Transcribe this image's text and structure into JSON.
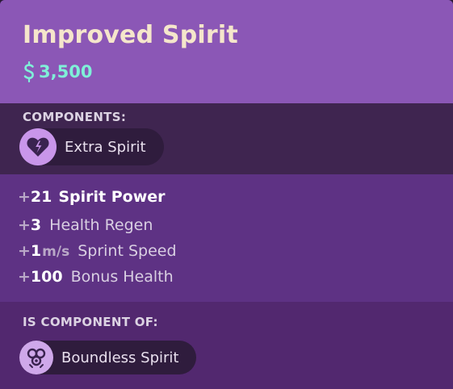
{
  "item": {
    "title": "Improved Spirit",
    "price": "3,500",
    "price_icon": "souls-currency-icon"
  },
  "components": {
    "label": "COMPONENTS:",
    "items": [
      {
        "label": "Extra Spirit",
        "icon": "broken-heart-spirit-icon"
      }
    ]
  },
  "stats": [
    {
      "plus": "+",
      "value": "21",
      "unit": "",
      "name": "Spirit Power"
    },
    {
      "plus": "+",
      "value": "3",
      "unit": "",
      "name": "Health Regen"
    },
    {
      "plus": "+",
      "value": "1",
      "unit": "m/s",
      "name": "Sprint Speed"
    },
    {
      "plus": "+",
      "value": "100",
      "unit": "",
      "name": "Bonus Health"
    }
  ],
  "component_of": {
    "label": "IS COMPONENT OF:",
    "items": [
      {
        "label": "Boundless Spirit",
        "icon": "spirit-swirl-icon"
      }
    ]
  },
  "colors": {
    "header_bg": "#8b57b6",
    "title": "#f5e6cb",
    "price": "#7ff0d8",
    "body_bg": "#5e3284"
  }
}
